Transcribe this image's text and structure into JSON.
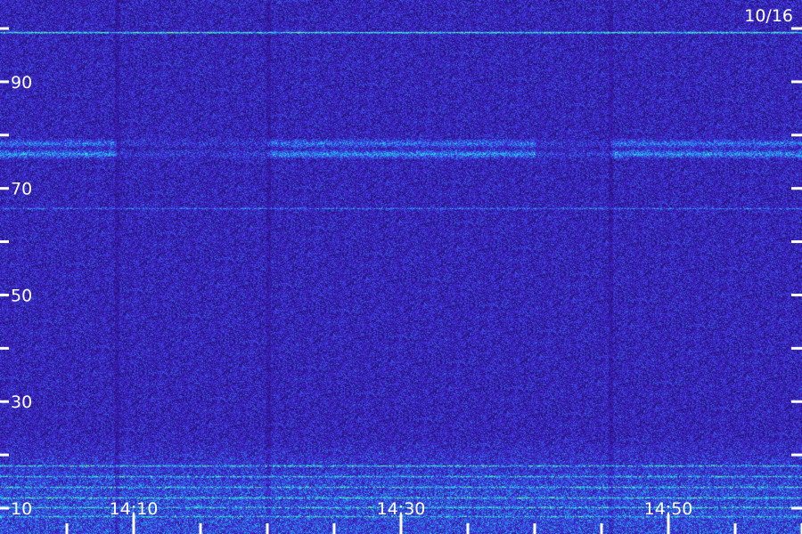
{
  "chart_data": {
    "type": "heatmap",
    "title": "",
    "xlabel": "",
    "ylabel": "",
    "date_label": "10/16",
    "x_range": [
      "14:00",
      "14:60"
    ],
    "ylim": [
      5,
      105
    ],
    "y_ticks": [
      {
        "value": 100,
        "label": ""
      },
      {
        "value": 90,
        "label": "90"
      },
      {
        "value": 80,
        "label": ""
      },
      {
        "value": 70,
        "label": "70"
      },
      {
        "value": 60,
        "label": ""
      },
      {
        "value": 50,
        "label": "50"
      },
      {
        "value": 40,
        "label": ""
      },
      {
        "value": 30,
        "label": "30"
      },
      {
        "value": 20,
        "label": ""
      },
      {
        "value": 10,
        "label": "10"
      }
    ],
    "x_ticks": [
      {
        "minute": 5,
        "label": ""
      },
      {
        "minute": 10,
        "label": "14:10"
      },
      {
        "minute": 15,
        "label": ""
      },
      {
        "minute": 20,
        "label": ""
      },
      {
        "minute": 25,
        "label": ""
      },
      {
        "minute": 30,
        "label": "14:30"
      },
      {
        "minute": 35,
        "label": ""
      },
      {
        "minute": 40,
        "label": ""
      },
      {
        "minute": 45,
        "label": ""
      },
      {
        "minute": 50,
        "label": "14:50"
      },
      {
        "minute": 55,
        "label": ""
      },
      {
        "minute": 60,
        "label": ""
      }
    ],
    "features": [
      {
        "name": "strong-line",
        "freq": 99.3,
        "intensity": 0.85
      },
      {
        "name": "band",
        "freq": 76.5,
        "intensity": 0.45
      },
      {
        "name": "band",
        "freq": 78.5,
        "intensity": 0.35
      },
      {
        "name": "faint-line",
        "freq": 66.3,
        "intensity": 0.35
      },
      {
        "name": "lf-line",
        "freq": 18.0,
        "intensity": 0.7
      },
      {
        "name": "lf-line",
        "freq": 16.0,
        "intensity": 0.6
      },
      {
        "name": "lf-line",
        "freq": 14.0,
        "intensity": 0.55
      },
      {
        "name": "lf-line",
        "freq": 12.0,
        "intensity": 0.6
      },
      {
        "name": "lf-line",
        "freq": 10.2,
        "intensity": 0.65
      },
      {
        "name": "lf-line",
        "freq": 8.5,
        "intensity": 0.5
      }
    ],
    "colors": {
      "background": "#1d0d5c",
      "noise_low": "#2a1b8c",
      "noise_high": "#5a4bff",
      "line_cyan": "#3ee0e8",
      "line_green": "#9cff3a",
      "axis": "#ffffff"
    }
  }
}
